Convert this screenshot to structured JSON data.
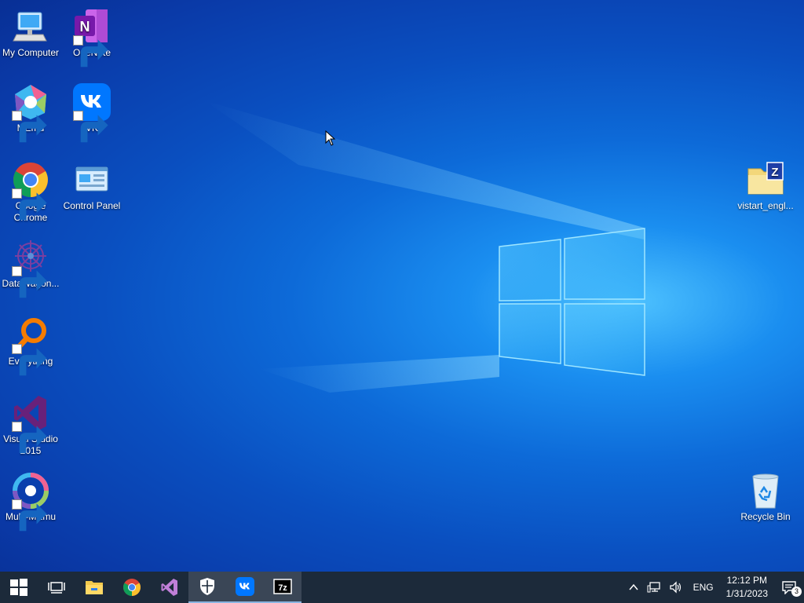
{
  "desktop": {
    "icons_left": [
      {
        "label": "My Computer",
        "icon": "monitor-icon"
      },
      {
        "label": "OneNote",
        "icon": "onenote-icon"
      },
      {
        "label": "MEmu",
        "icon": "memu-icon"
      },
      {
        "label": "VK",
        "icon": "vk-icon"
      },
      {
        "label": "Google Chrome",
        "icon": "chrome-icon"
      },
      {
        "label": "Control Panel",
        "icon": "control-panel-icon"
      },
      {
        "label": "DataWagon...",
        "icon": "datawagon-icon"
      },
      {
        "label": "Everything",
        "icon": "everything-search-icon"
      },
      {
        "label": "Visual Studio 2015",
        "icon": "visual-studio-icon"
      },
      {
        "label": "Multi-MEmu",
        "icon": "multi-memu-icon"
      }
    ],
    "icons_right": [
      {
        "label": "vistart_engl...",
        "icon": "zip-folder-icon"
      },
      {
        "label": "Recycle Bin",
        "icon": "recycle-bin-icon"
      }
    ]
  },
  "taskbar": {
    "items": [
      {
        "name": "start-button",
        "icon": "windows-logo-icon"
      },
      {
        "name": "task-view-button",
        "icon": "task-view-icon"
      },
      {
        "name": "file-explorer-button",
        "icon": "folder-icon"
      },
      {
        "name": "chrome-button",
        "icon": "chrome-icon"
      },
      {
        "name": "visual-studio-button",
        "icon": "visual-studio-icon"
      },
      {
        "name": "security-button",
        "icon": "shield-icon"
      },
      {
        "name": "vk-button",
        "icon": "vk-icon"
      },
      {
        "name": "7zip-button",
        "icon": "7zip-icon"
      }
    ],
    "tray": {
      "language": "ENG",
      "time": "12:12 PM",
      "date": "1/31/2023",
      "notifications_count": "3"
    }
  },
  "colors": {
    "taskbar": "#1c2a3a",
    "desktop_accent": "#1a8ef0"
  }
}
